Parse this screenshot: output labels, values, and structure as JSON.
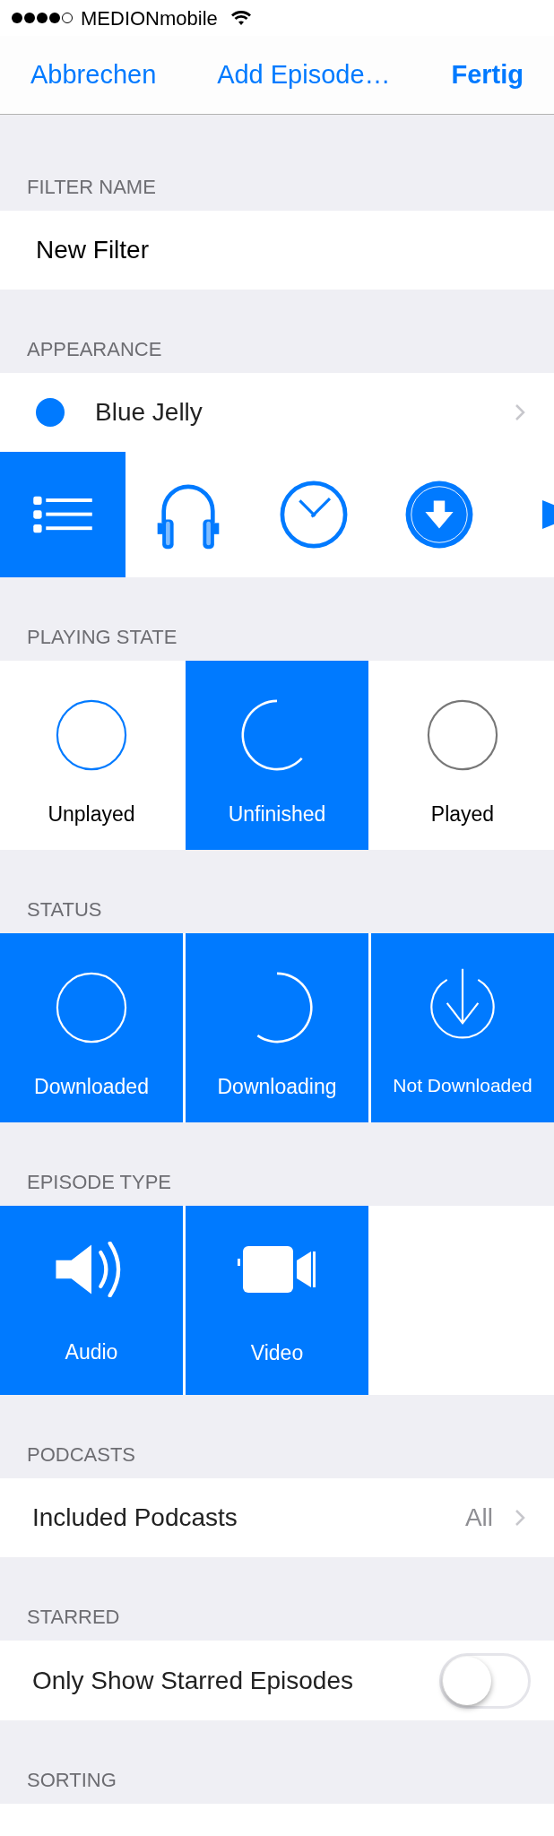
{
  "status_bar": {
    "carrier": "MEDIONmobile"
  },
  "nav": {
    "cancel": "Abbrechen",
    "title": "Add Episode…",
    "done": "Fertig"
  },
  "sections": [
    {
      "header": "FILTER NAME",
      "kind": "field",
      "value": "New Filter"
    },
    {
      "header": "APPEARANCE",
      "kind": "appearance",
      "color_name": "Blue Jelly",
      "color": "#007aff",
      "icons": [
        {
          "kind": "list",
          "selected": true
        },
        {
          "kind": "headphones",
          "selected": false
        },
        {
          "kind": "clock",
          "selected": false
        },
        {
          "kind": "download",
          "selected": false
        },
        {
          "kind": "play",
          "selected": false
        }
      ]
    },
    {
      "header": "PLAYING STATE",
      "kind": "tiles",
      "tiles": [
        {
          "label": "Unplayed",
          "kind": "circle",
          "selected": false
        },
        {
          "label": "Unfinished",
          "kind": "arc",
          "selected": true
        },
        {
          "label": "Played",
          "kind": "faded-circle",
          "selected": false
        }
      ]
    },
    {
      "header": "STATUS",
      "kind": "tiles",
      "tiles": [
        {
          "label": "Downloaded",
          "kind": "circle",
          "selected": true
        },
        {
          "label": "Downloading",
          "kind": "progress",
          "selected": true
        },
        {
          "label": "Not Downloaded",
          "kind": "arrow-circle",
          "selected": true
        }
      ]
    },
    {
      "header": "EPISODE TYPE",
      "kind": "tiles",
      "tiles": [
        {
          "label": "Audio",
          "kind": "speaker",
          "selected": true
        },
        {
          "label": "Video",
          "kind": "camera",
          "selected": true
        }
      ]
    },
    {
      "header": "PODCASTS",
      "kind": "disclosure",
      "label": "Included Podcasts",
      "value": "All"
    },
    {
      "header": "STARRED",
      "kind": "toggle",
      "label": "Only Show Starred Episodes",
      "on": false
    },
    {
      "header": "SORTING",
      "kind": "header"
    }
  ]
}
